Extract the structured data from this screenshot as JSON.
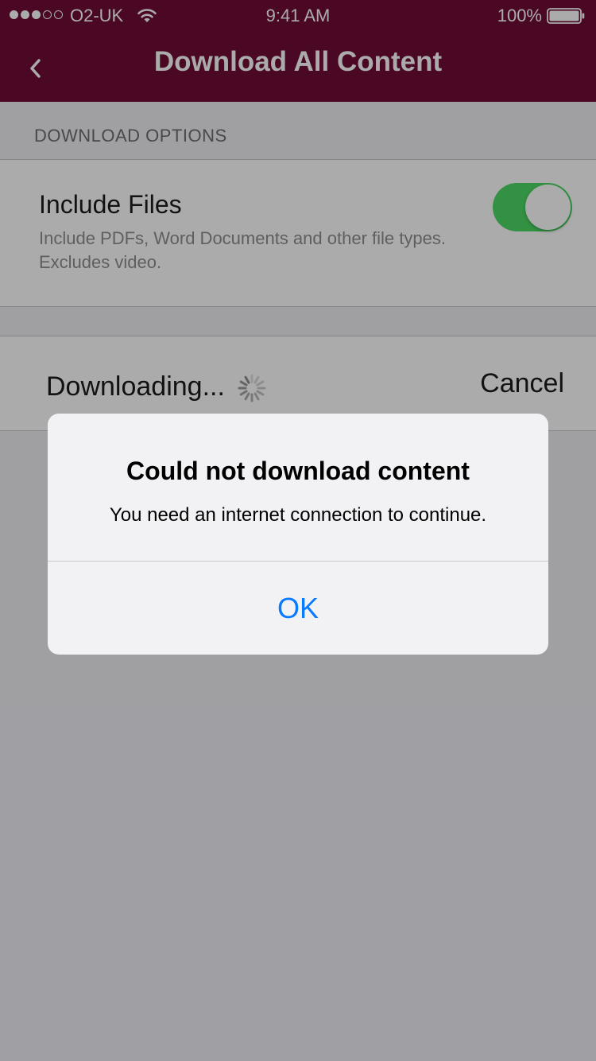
{
  "status_bar": {
    "carrier": "O2-UK",
    "time": "9:41 AM",
    "battery": "100%",
    "signal_bars_filled": 3,
    "signal_bars_total": 5
  },
  "nav": {
    "title": "Download All Content",
    "back_icon": "chevron-left-icon"
  },
  "download_options": {
    "section_header": "DOWNLOAD OPTIONS",
    "include_files": {
      "title": "Include Files",
      "description": "Include PDFs, Word Documents and other file types. Excludes video.",
      "enabled": true
    }
  },
  "download_status": {
    "label": "Downloading...",
    "cancel_label": "Cancel"
  },
  "alert": {
    "title": "Could not download content",
    "message": "You need an internet connection to continue.",
    "ok_label": "OK"
  },
  "colors": {
    "header": "#6f0d37",
    "toggle_on": "#4cd964",
    "alert_button": "#0a7aff"
  }
}
